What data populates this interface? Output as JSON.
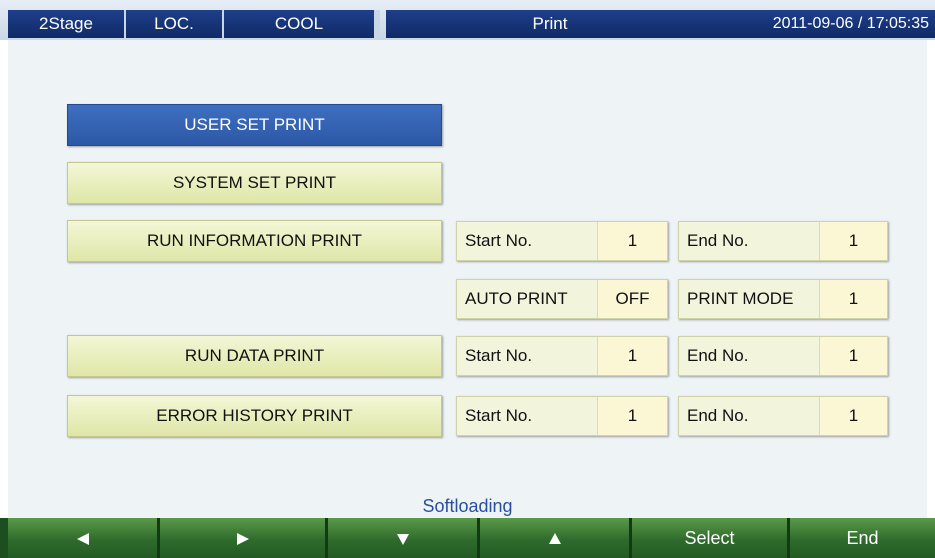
{
  "header": {
    "stage": "2Stage",
    "location": "LOC.",
    "mode": "COOL",
    "title": "Print",
    "datetime": "2011-09-06 / 17:05:35"
  },
  "menu": {
    "user_set_print": "USER SET PRINT",
    "system_set_print": "SYSTEM SET PRINT",
    "run_information_print": "RUN INFORMATION PRINT",
    "run_data_print": "RUN DATA PRINT",
    "error_history_print": "ERROR HISTORY PRINT"
  },
  "run_information": {
    "start_label": "Start No.",
    "start_value": "1",
    "end_label": "End No.",
    "end_value": "1"
  },
  "auto": {
    "auto_print_label": "AUTO PRINT",
    "auto_print_value": "OFF",
    "print_mode_label": "PRINT MODE",
    "print_mode_value": "1"
  },
  "run_data": {
    "start_label": "Start No.",
    "start_value": "1",
    "end_label": "End No.",
    "end_value": "1"
  },
  "error_history": {
    "start_label": "Start No.",
    "start_value": "1",
    "end_label": "End No.",
    "end_value": "1"
  },
  "status": "Softloading",
  "footer": {
    "left_icon": "triangle-left-icon",
    "right_icon": "triangle-right-icon",
    "down_icon": "triangle-down-icon",
    "up_icon": "triangle-up-icon",
    "select_label": "Select",
    "end_label": "End"
  },
  "colors": {
    "header_blue": "#0f2a66",
    "selected_blue": "#2c58a6",
    "button_yellow": "#dfe6a8",
    "footer_green": "#2f6b2c",
    "status_blue": "#2a4f9e"
  }
}
